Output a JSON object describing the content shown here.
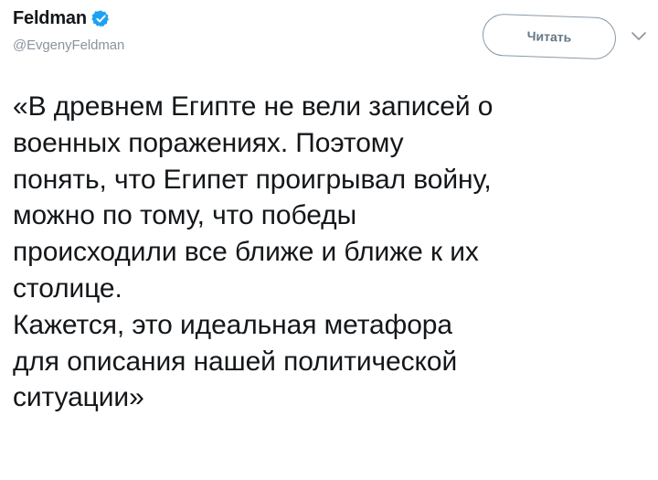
{
  "tweet": {
    "display_name": "Feldman",
    "handle": "@EvgenyFeldman",
    "verified_icon": "verified-badge-icon",
    "follow_label": "Читать",
    "menu_icon": "chevron-down-icon",
    "text": "«В древнем Египте не вели записей о\nвоенных поражениях. Поэтому\nпонять, что Египет проигрывал войну,\nможно по тому, что победы\nпроисходили все ближе и ближе к их\nстолице.\nКажется, это идеальная метафора\nдля описания нашей политической\nситуации»"
  },
  "colors": {
    "verified_blue": "#1da1f2",
    "text": "#14171a",
    "secondary": "#8a949e",
    "button_border": "#8a9aa6"
  }
}
